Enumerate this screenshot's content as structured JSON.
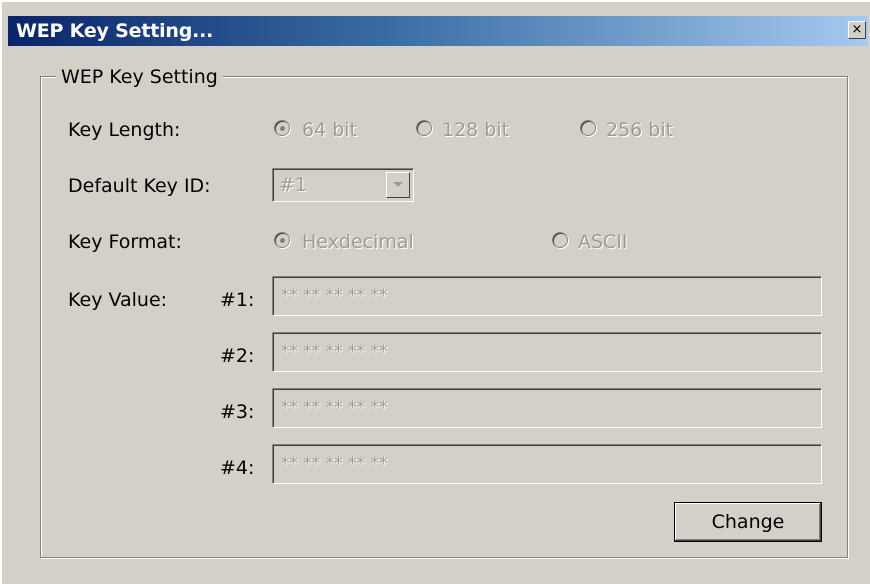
{
  "window": {
    "title": "WEP Key Setting...",
    "close_glyph": "×"
  },
  "group": {
    "legend": "WEP Key Setting"
  },
  "key_length": {
    "label": "Key Length:",
    "options": [
      "64 bit",
      "128 bit",
      "256 bit"
    ],
    "selected": "64 bit",
    "enabled": false
  },
  "default_key_id": {
    "label": "Default Key ID:",
    "value": "#1",
    "enabled": false
  },
  "key_format": {
    "label": "Key Format:",
    "options": [
      "Hexdecimal",
      "ASCII"
    ],
    "selected": "Hexdecimal",
    "enabled": false
  },
  "key_value": {
    "label": "Key Value:",
    "keys": [
      {
        "id": "#1:",
        "value": "** ** ** ** **"
      },
      {
        "id": "#2:",
        "value": "** ** ** ** **"
      },
      {
        "id": "#3:",
        "value": "** ** ** ** **"
      },
      {
        "id": "#4:",
        "value": "** ** ** ** **"
      }
    ],
    "enabled": false
  },
  "buttons": {
    "change_label": "Change"
  },
  "colors": {
    "dialog_bg": "#d4d0c8",
    "title_start": "#0a246a",
    "title_end": "#a6caf0",
    "disabled_text": "#a09c94"
  }
}
